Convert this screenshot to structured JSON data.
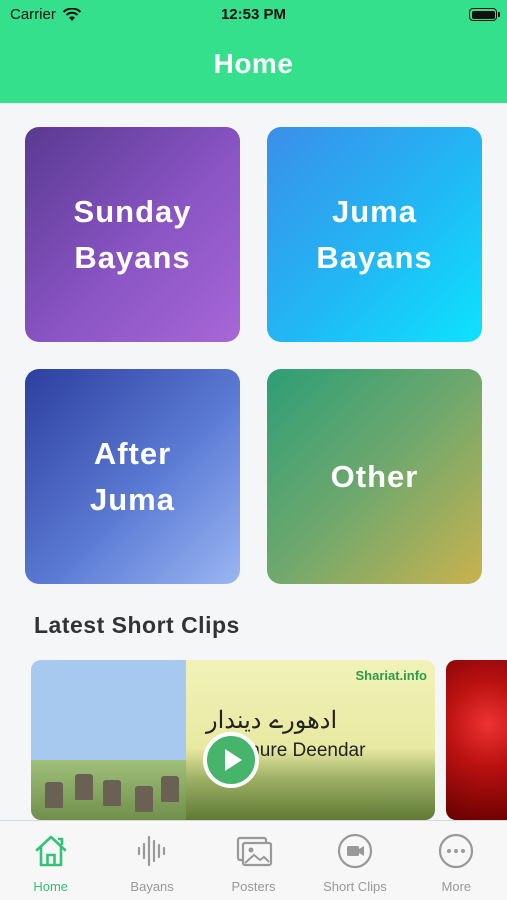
{
  "status_bar": {
    "carrier": "Carrier",
    "time": "12:53 PM"
  },
  "header": {
    "title": "Home",
    "color": "#34e08c"
  },
  "categories": [
    {
      "label": "Sunday\nBayans"
    },
    {
      "label": "Juma\nBayans"
    },
    {
      "label": "After\nJuma"
    },
    {
      "label": "Other"
    }
  ],
  "latest": {
    "section_title": "Latest Short Clips",
    "clips": [
      {
        "title": "Adhure Deendar",
        "urdu_title": "ادھورے دیندار",
        "brand": "Shariat.info",
        "icon": "play-icon"
      }
    ]
  },
  "tabbar": {
    "active_color": "#34c27a",
    "tabs": [
      {
        "label": "Home",
        "icon": "home-icon",
        "active": true
      },
      {
        "label": "Bayans",
        "icon": "waveform-icon",
        "active": false
      },
      {
        "label": "Posters",
        "icon": "photos-icon",
        "active": false
      },
      {
        "label": "Short Clips",
        "icon": "video-icon",
        "active": false
      },
      {
        "label": "More",
        "icon": "more-icon",
        "active": false
      }
    ]
  }
}
